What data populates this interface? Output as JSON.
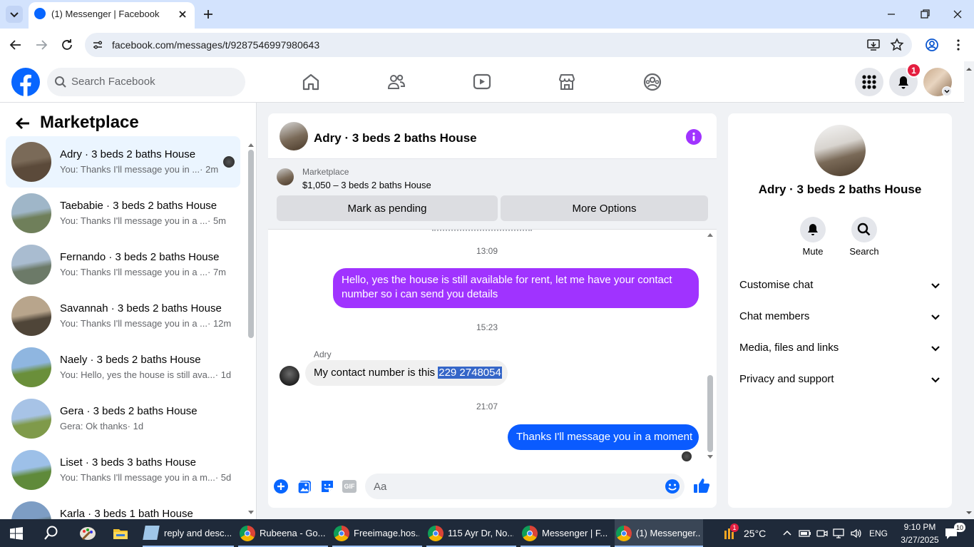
{
  "browser": {
    "tab_title": "(1) Messenger | Facebook",
    "url": "facebook.com/messages/t/9287546997980643"
  },
  "fb_nav": {
    "search_placeholder": "Search Facebook",
    "notification_count": "1"
  },
  "sidebar": {
    "title": "Marketplace",
    "conversations": [
      {
        "title": "Adry · 3 beds 2 baths House",
        "snippet": "You: Thanks I'll message you in ...",
        "time": "· 2m",
        "colors": [
          "#7a6a58",
          "#5b4a3a"
        ]
      },
      {
        "title": "Taebabie · 3 beds 2 baths House",
        "snippet": "You: Thanks I'll message you in a ...",
        "time": "· 5m",
        "colors": [
          "#9fb6c8",
          "#6f7f5a"
        ]
      },
      {
        "title": "Fernando · 3 beds 2 baths House",
        "snippet": "You: Thanks I'll message you in a ...",
        "time": "· 7m",
        "colors": [
          "#a9bcd0",
          "#6c7a68"
        ]
      },
      {
        "title": "Savannah · 3 beds 2 baths House",
        "snippet": "You: Thanks I'll message you in a ...",
        "time": "· 12m",
        "colors": [
          "#b8a58c",
          "#4f4538"
        ]
      },
      {
        "title": "Naely · 3 beds 2 baths House",
        "snippet": "You: Hello, yes the house is still ava...",
        "time": "· 1d",
        "colors": [
          "#8fb6e0",
          "#6a8f3a"
        ]
      },
      {
        "title": "Gera · 3 beds 2 baths House",
        "snippet": "Gera: Ok thanks",
        "time": "· 1d",
        "colors": [
          "#a7c3e6",
          "#7f9a4a"
        ]
      },
      {
        "title": "Liset · 3 beds 3 baths House",
        "snippet": "You: Thanks I'll message you in a m...",
        "time": "· 5d",
        "colors": [
          "#9dc0e8",
          "#5f8a3a"
        ]
      },
      {
        "title": "Karla · 3 beds 1 bath House",
        "snippet": "",
        "time": "",
        "colors": [
          "#7d9dc4",
          "#4c5a44"
        ]
      }
    ]
  },
  "chat": {
    "title": "Adry · 3 beds 2 baths House",
    "listing_label": "Marketplace",
    "listing_price": "$1,050 – 3 beds 2 baths House",
    "pending_button": "Mark as pending",
    "options_button": "More Options",
    "time1": "13:09",
    "msg_out_1": "Hello, yes the house is still available for rent, let me have your contact number so i can send you  details",
    "time2": "15:23",
    "sender_name": "Adry",
    "msg_in_text": "My contact number is this ",
    "msg_in_selected": "229 2748054",
    "time3": "21:07",
    "msg_out_2": "Thanks I'll message you in a moment",
    "composer_placeholder": "Aa"
  },
  "info_panel": {
    "title": "Adry · 3 beds 2 baths House",
    "mute_label": "Mute",
    "search_label": "Search",
    "rows": [
      "Customise chat",
      "Chat members",
      "Media, files and links",
      "Privacy and support"
    ]
  },
  "taskbar": {
    "items": [
      "reply and desc...",
      "Rubeena - Go...",
      "Freeimage.hos...",
      "115 Ayr Dr, No...",
      "Messenger | F...",
      "(1) Messenger..."
    ],
    "weather_badge": "1",
    "temperature": "25°C",
    "language": "ENG",
    "time": "9:10 PM",
    "date": "3/27/2025",
    "notification_badge": "10"
  },
  "colors": {
    "facebook_blue": "#0866ff",
    "messenger_purple": "#a033ff",
    "selection_blue": "#3566c8",
    "badge_red": "#e41e3f"
  }
}
